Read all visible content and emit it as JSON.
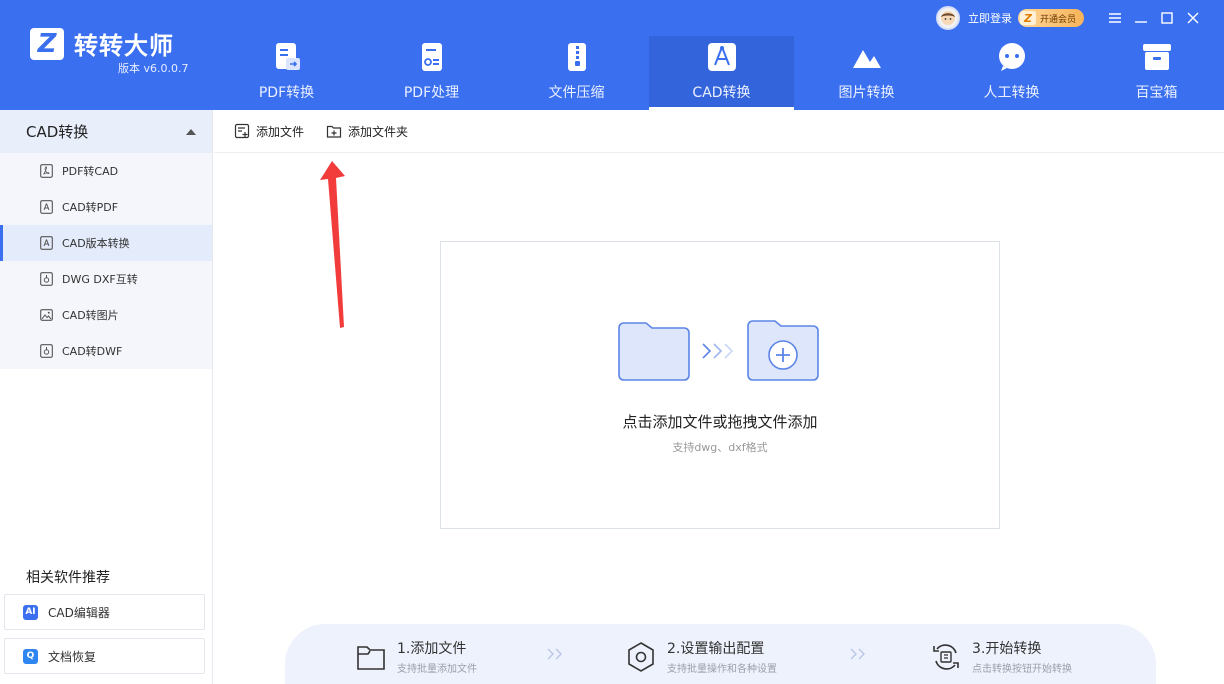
{
  "app": {
    "name": "转转大师",
    "version": "版本 v6.0.0.7",
    "login": "立即登录",
    "vip": "开通会员"
  },
  "nav": [
    {
      "label": "PDF转换",
      "icon": "pdf-convert-icon"
    },
    {
      "label": "PDF处理",
      "icon": "pdf-process-icon"
    },
    {
      "label": "文件压缩",
      "icon": "zip-icon"
    },
    {
      "label": "CAD转换",
      "icon": "cad-icon",
      "active": true
    },
    {
      "label": "图片转换",
      "icon": "image-icon"
    },
    {
      "label": "人工转换",
      "icon": "chat-icon"
    },
    {
      "label": "百宝箱",
      "icon": "toolbox-icon"
    }
  ],
  "sidebar": {
    "section": "CAD转换",
    "items": [
      {
        "label": "PDF转CAD"
      },
      {
        "label": "CAD转PDF"
      },
      {
        "label": "CAD版本转换",
        "active": true
      },
      {
        "label": "DWG DXF互转"
      },
      {
        "label": "CAD转图片"
      },
      {
        "label": "CAD转DWF"
      }
    ],
    "recommend_title": "相关软件推荐",
    "recommend": [
      {
        "label": "CAD编辑器",
        "icon_text": "AI"
      },
      {
        "label": "文档恢复",
        "icon_text": "Q"
      }
    ]
  },
  "toolbar": {
    "add_file": "添加文件",
    "add_folder": "添加文件夹"
  },
  "dropzone": {
    "title": "点击添加文件或拖拽文件添加",
    "subtitle": "支持dwg、dxf格式"
  },
  "steps": [
    {
      "title": "1.添加文件",
      "desc": "支持批量添加文件"
    },
    {
      "title": "2.设置输出配置",
      "desc": "支持批量操作和各种设置"
    },
    {
      "title": "3.开始转换",
      "desc": "点击转换按钮开始转换"
    }
  ],
  "colors": {
    "brand": "#3a6ff0",
    "arrow": "#f23c3c"
  }
}
